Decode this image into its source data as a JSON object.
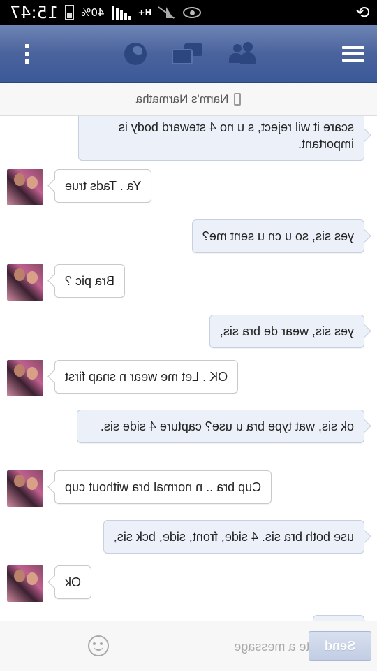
{
  "status_bar": {
    "time": "15:47",
    "battery_percent": "40%",
    "network_type": "H+",
    "icons": [
      "sync-icon",
      "eye-icon",
      "muted-icon",
      "network-icon",
      "signal-icon",
      "battery-icon"
    ]
  },
  "nav": {
    "icons": [
      "menu-icon",
      "friend-requests-icon",
      "messages-icon",
      "notifications-globe-icon",
      "overflow-menu-icon"
    ]
  },
  "conversation": {
    "contact_name": "Narm's Narmatha"
  },
  "messages": [
    {
      "from": "them",
      "text": "scare it wil reject, s u no 4 steward body is important."
    },
    {
      "from": "me",
      "text": "Ya . Tads true"
    },
    {
      "from": "them",
      "text": "yes sis, so u cn u sent me?"
    },
    {
      "from": "me",
      "text": "Bra pic ?"
    },
    {
      "from": "them",
      "text": "yes sis, wear de bra sis,"
    },
    {
      "from": "me",
      "text": "OK . Let me wear n snap first"
    },
    {
      "from": "them",
      "text": "ok sis, wat type bra u use? capture 4 side sis."
    },
    {
      "from": "me",
      "text": "Cup bra .. n normal bra without cup"
    },
    {
      "from": "them",
      "text": "use both bra sis. 4 side, front, side, bck sis,"
    },
    {
      "from": "me",
      "text": "Ok"
    }
  ],
  "composer": {
    "placeholder": "Write a message",
    "send_label": "Send"
  },
  "colors": {
    "nav_blue": "#3b5998",
    "incoming_bubble": "#ecf1f9",
    "outgoing_bubble": "#ffffff"
  }
}
